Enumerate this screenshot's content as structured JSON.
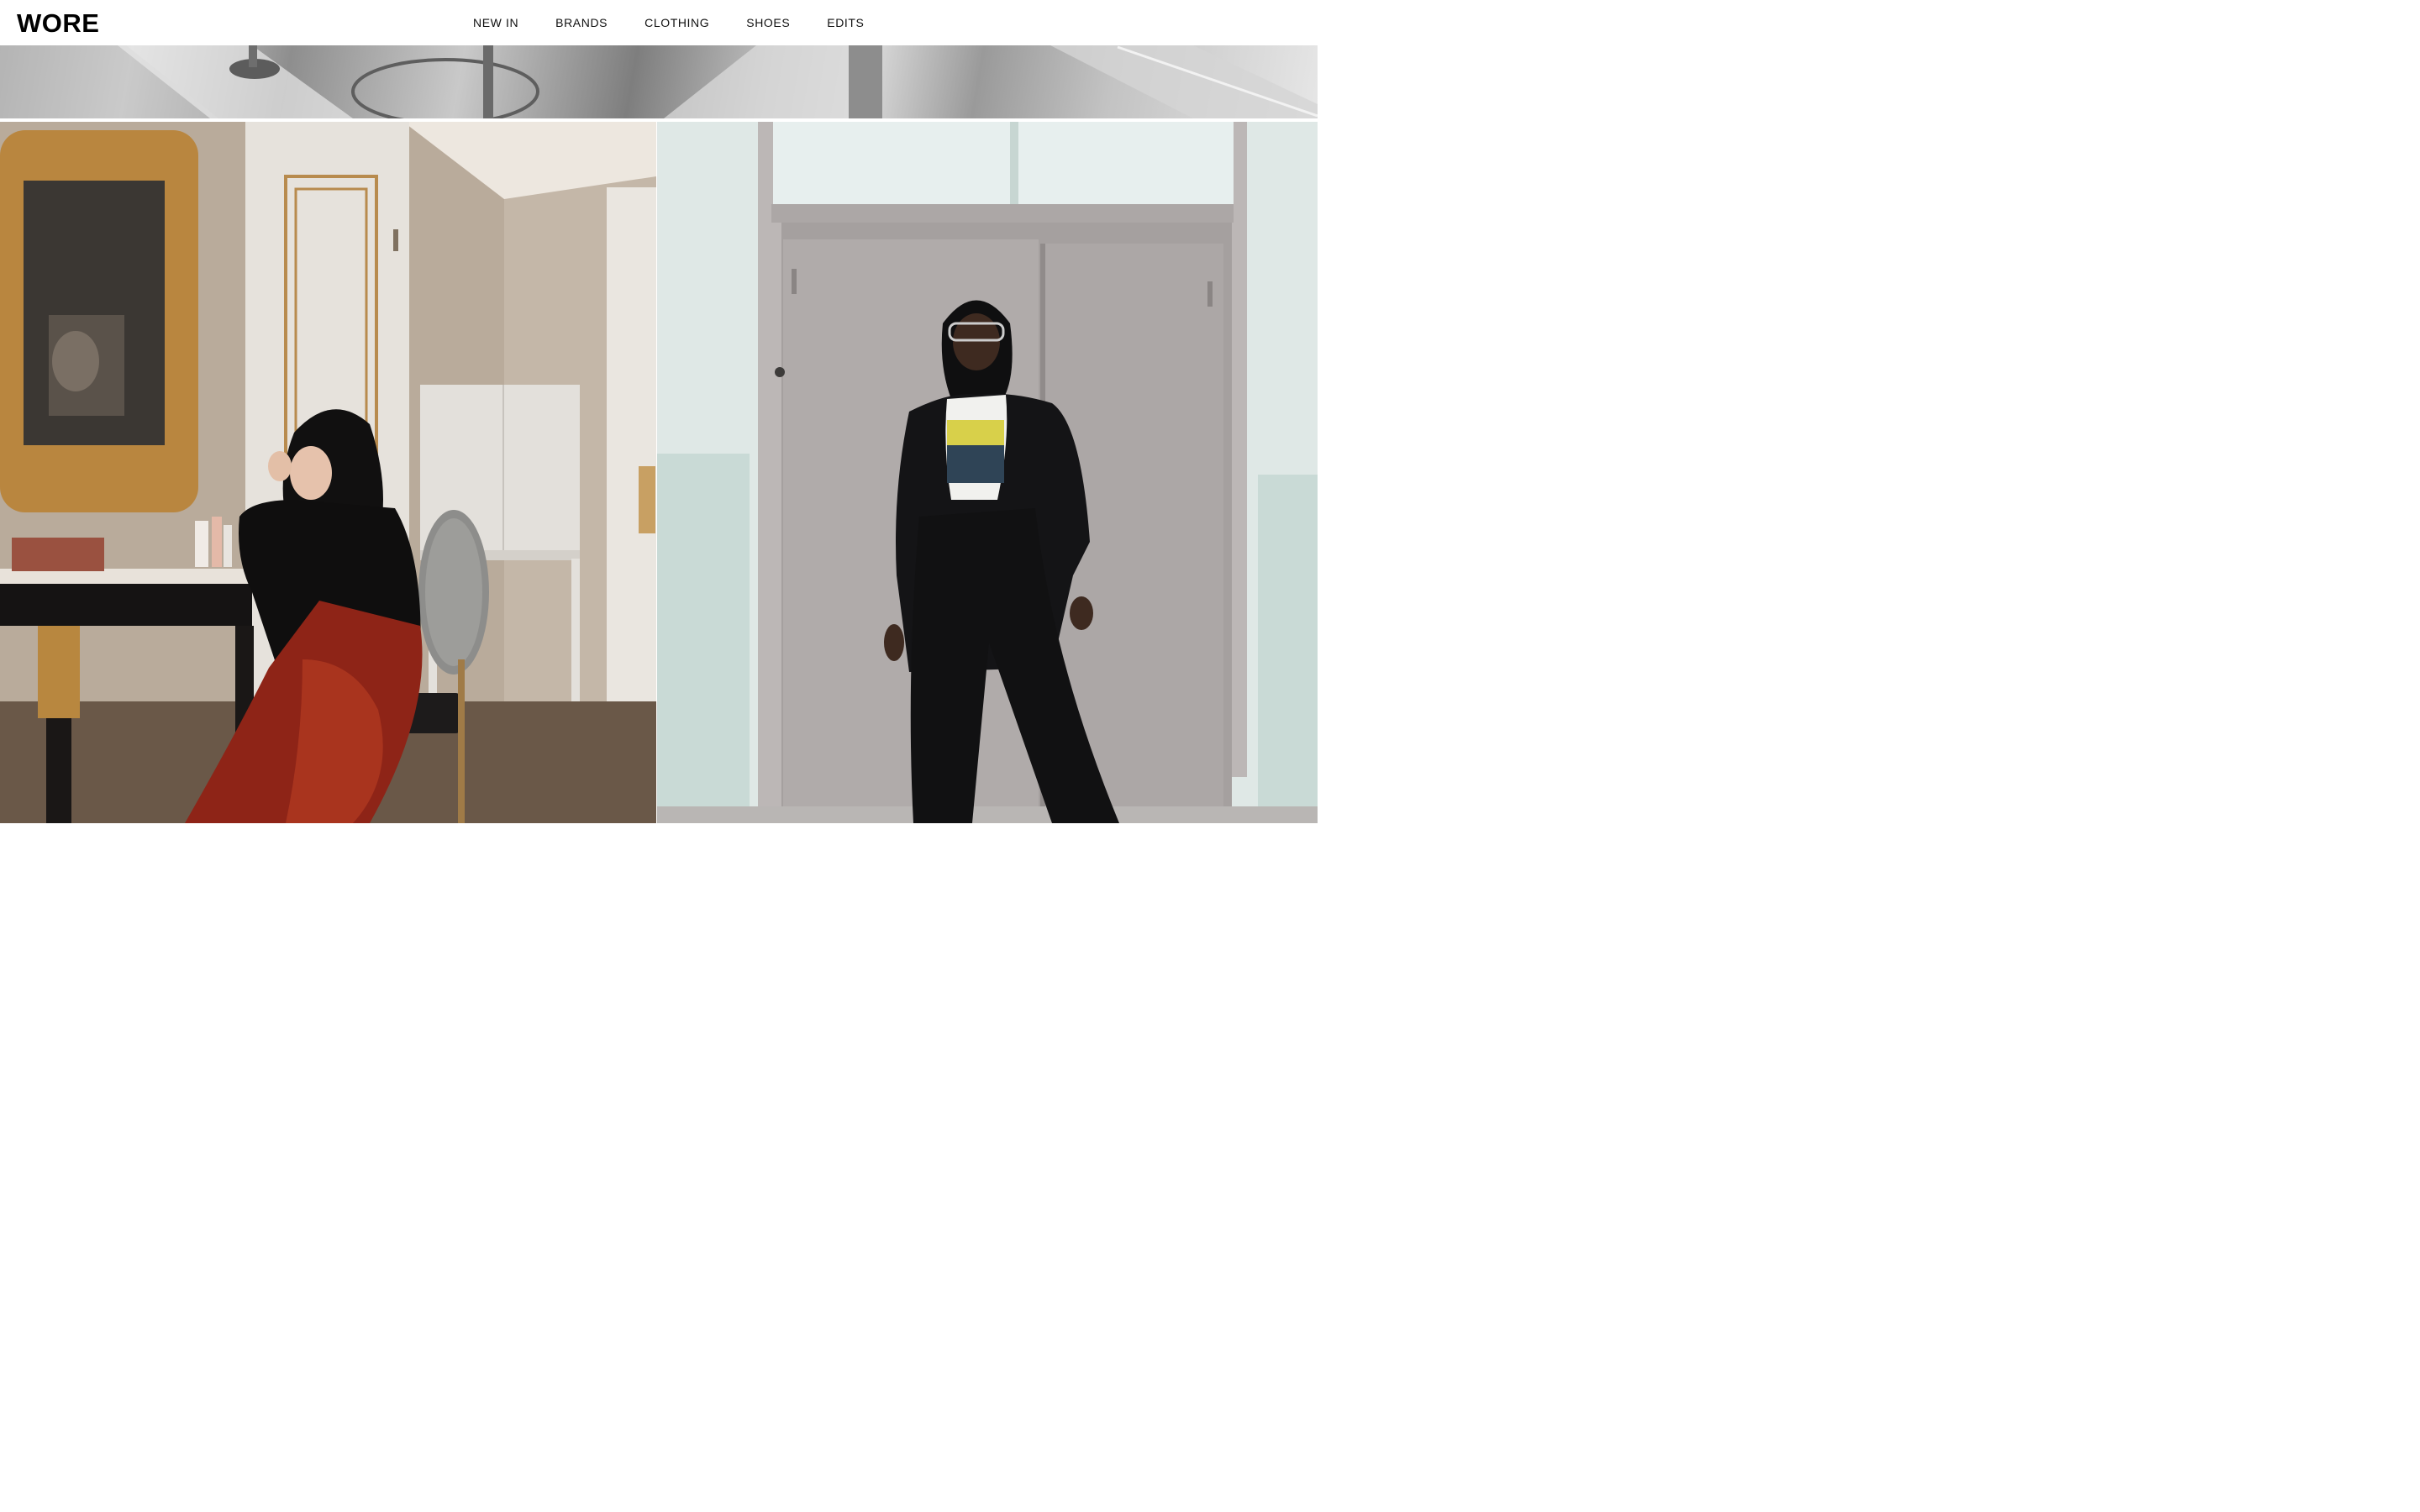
{
  "header": {
    "logo": "WORE",
    "nav": [
      {
        "label": "NEW IN"
      },
      {
        "label": "BRANDS"
      },
      {
        "label": "CLOTHING"
      },
      {
        "label": "SHOES"
      },
      {
        "label": "EDITS"
      }
    ]
  },
  "hero": {
    "strip_tone": "grayscale"
  },
  "tiles": [
    {
      "id": "left",
      "subject": "photo"
    },
    {
      "id": "right",
      "subject": "photo"
    }
  ],
  "colors": {
    "text": "#000000",
    "background": "#ffffff"
  }
}
